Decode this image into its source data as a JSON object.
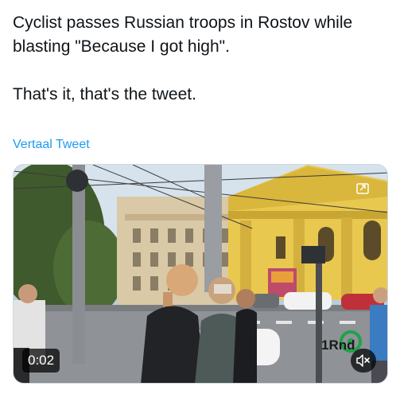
{
  "tweet": {
    "text": "Cyclist passes Russian troops in Rostov while blasting \"Because I got high\".\n\nThat's it, that's the tweet.",
    "translate_label": "Vertaal Tweet"
  },
  "video": {
    "timestamp": "0:02",
    "watermark": "1Rnd",
    "mute_icon": "speaker-muted-icon",
    "corner_icon": "picture-in-picture-icon",
    "sky_color": "#b9cde0",
    "building_color": "#e8c84f"
  }
}
